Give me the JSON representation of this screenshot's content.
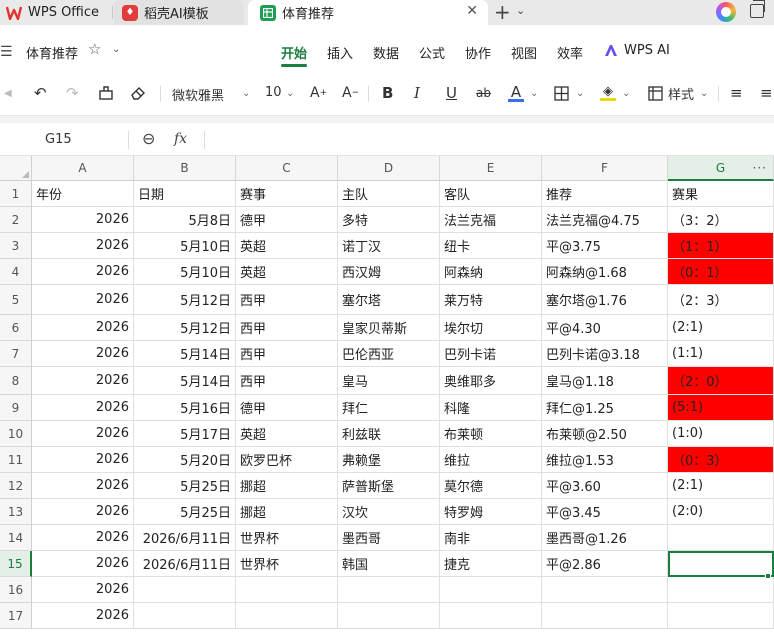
{
  "tabs": [
    {
      "label": "WPS Office"
    },
    {
      "label": "稻壳AI模板"
    },
    {
      "label": "体育推荐"
    }
  ],
  "menu": {
    "doc_name": "体育推荐",
    "items": [
      "开始",
      "插入",
      "数据",
      "公式",
      "协作",
      "视图",
      "效率",
      "WPS AI"
    ],
    "active": "开始"
  },
  "toolbar": {
    "font_name": "微软雅黑",
    "font_size": "10",
    "style_label": "样式",
    "font_color": "#3b6df0",
    "fill_color": "#f2d600"
  },
  "formula_bar": {
    "name_box": "G15",
    "fx_label": "fx",
    "content": ""
  },
  "sheet": {
    "columns": [
      "A",
      "B",
      "C",
      "D",
      "E",
      "F",
      "G"
    ],
    "selected_column": "G",
    "selected_row": "15",
    "highlight_color": "#ff0000",
    "rows": [
      {
        "n": "1",
        "cells": [
          "年份",
          "日期",
          "赛事",
          "主队",
          "客队",
          "推荐",
          "赛果"
        ],
        "red": false
      },
      {
        "n": "2",
        "cells": [
          "2026",
          "5月8日",
          "德甲",
          "多特",
          "法兰克福",
          "法兰克福@4.75",
          "（3：2）"
        ],
        "red": false
      },
      {
        "n": "3",
        "cells": [
          "2026",
          "5月10日",
          "英超",
          "诺丁汉",
          "纽卡",
          "平@3.75",
          "（1：1）"
        ],
        "red": true
      },
      {
        "n": "4",
        "cells": [
          "2026",
          "5月10日",
          "英超",
          "西汉姆",
          "阿森纳",
          "阿森纳@1.68",
          "（0：1）"
        ],
        "red": true
      },
      {
        "n": "5",
        "cells": [
          "2026",
          "5月12日",
          "西甲",
          "塞尔塔",
          "莱万特",
          "塞尔塔@1.76",
          "（2：3）"
        ],
        "red": false
      },
      {
        "n": "6",
        "cells": [
          "2026",
          "5月12日",
          "西甲",
          "皇家贝蒂斯",
          "埃尔切",
          "平@4.30",
          "(2:1)"
        ],
        "red": false
      },
      {
        "n": "7",
        "cells": [
          "2026",
          "5月14日",
          "西甲",
          "巴伦西亚",
          "巴列卡诺",
          "巴列卡诺@3.18",
          "(1:1)"
        ],
        "red": false
      },
      {
        "n": "8",
        "cells": [
          "2026",
          "5月14日",
          "西甲",
          "皇马",
          "奥维耶多",
          "皇马@1.18",
          "（2：0）"
        ],
        "red": true
      },
      {
        "n": "9",
        "cells": [
          "2026",
          "5月16日",
          "德甲",
          "拜仁",
          "科隆",
          "拜仁@1.25",
          "(5:1)"
        ],
        "red": true
      },
      {
        "n": "10",
        "cells": [
          "2026",
          "5月17日",
          "英超",
          "利兹联",
          "布莱顿",
          "布莱顿@2.50",
          "(1:0)"
        ],
        "red": false
      },
      {
        "n": "11",
        "cells": [
          "2026",
          "5月20日",
          "欧罗巴杯",
          "弗赖堡",
          "维拉",
          "维拉@1.53",
          "（0：3）"
        ],
        "red": true
      },
      {
        "n": "12",
        "cells": [
          "2026",
          "5月25日",
          "挪超",
          "萨普斯堡",
          "莫尔德",
          "平@3.60",
          "(2:1)"
        ],
        "red": false
      },
      {
        "n": "13",
        "cells": [
          "2026",
          "5月25日",
          "挪超",
          "汉坎",
          "特罗姆",
          "平@3.45",
          "(2:0)"
        ],
        "red": false
      },
      {
        "n": "14",
        "cells": [
          "2026",
          "2026/6月11日",
          "世界杯",
          "墨西哥",
          "南非",
          "墨西哥@1.26",
          ""
        ],
        "red": false
      },
      {
        "n": "15",
        "cells": [
          "2026",
          "2026/6月11日",
          "世界杯",
          "韩国",
          "捷克",
          "平@2.86",
          ""
        ],
        "red": false
      },
      {
        "n": "16",
        "cells": [
          "2026",
          "",
          "",
          "",
          "",
          "",
          ""
        ],
        "red": false
      },
      {
        "n": "17",
        "cells": [
          "2026",
          "",
          "",
          "",
          "",
          "",
          ""
        ],
        "red": false
      }
    ]
  }
}
